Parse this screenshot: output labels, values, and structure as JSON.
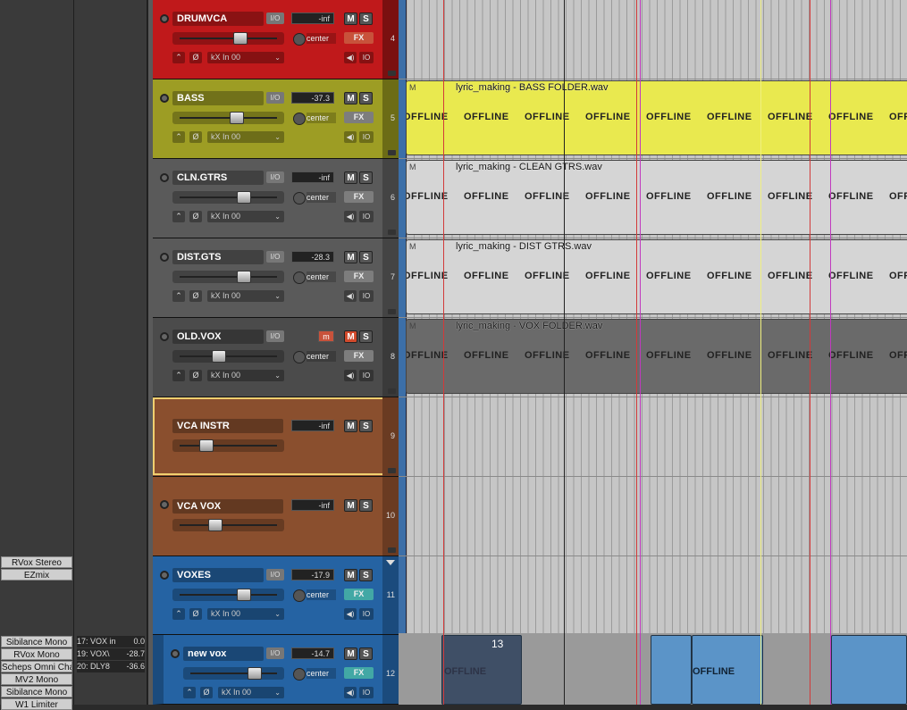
{
  "mixer": {
    "slots_a": [
      "RVox Stereo",
      "EZmix"
    ],
    "slots_b": [
      "Sibilance Mono",
      "RVox Mono",
      "Scheps Omni Cha",
      "MV2 Mono",
      "Sibilance Mono",
      "W1 Limiter"
    ],
    "sends": [
      {
        "label": "17: VOX in",
        "val": "0.0"
      },
      {
        "label": "19: VOX\\",
        "val": "-28.7"
      },
      {
        "label": "20: DLY8",
        "val": "-36.6"
      }
    ]
  },
  "tracks": [
    {
      "num": "4",
      "name": "DRUMVCA",
      "vol": "-inf",
      "pan": "center",
      "fx": "FX",
      "input": "kX In 00",
      "color": "#c0191b"
    },
    {
      "num": "5",
      "name": "BASS",
      "vol": "-37.3",
      "pan": "center",
      "fx": "FX",
      "input": "kX In 00",
      "color": "#9d9d24"
    },
    {
      "num": "6",
      "name": "CLN.GTRS",
      "vol": "-inf",
      "pan": "center",
      "fx": "FX",
      "input": "kX In 00",
      "color": "#5a5a5a"
    },
    {
      "num": "7",
      "name": "DIST.GTS",
      "vol": "-28.3",
      "pan": "center",
      "fx": "FX",
      "input": "kX In 00",
      "color": "#5a5a5a"
    },
    {
      "num": "8",
      "name": "OLD.VOX",
      "vol": "m",
      "pan": "center",
      "fx": "FX",
      "input": "kX In 00",
      "color": "#4b4b4b"
    },
    {
      "num": "9",
      "name": "VCA INSTR",
      "vol": "-inf",
      "color": "#8a4f2e"
    },
    {
      "num": "10",
      "name": "VCA VOX",
      "vol": "-inf",
      "color": "#8a4f2e"
    },
    {
      "num": "11",
      "name": "VOXES",
      "vol": "-17.9",
      "pan": "center",
      "fx": "FX",
      "input": "kX In 00",
      "color": "#2563a3"
    },
    {
      "num": "12",
      "name": "new vox",
      "vol": "-14.7",
      "pan": "center",
      "fx": "FX",
      "input": "kX In 00",
      "color": "#2563a3"
    }
  ],
  "buttons": {
    "io": "I/O",
    "mute": "M",
    "solo": "S",
    "mon": "◀)",
    "io2": "IO",
    "auto": "⌃",
    "phase": "Ø",
    "chev": "⌄"
  },
  "items": {
    "bass": "lyric_making - BASS FOLDER.wav",
    "clean": "lyric_making - CLEAN GTRS.wav",
    "dist": "lyric_making - DIST GTRS.wav",
    "vox": "lyric_making - VOX FOLDER.wav",
    "offline": "OFFLINE",
    "small": "13",
    "item_icons": "M"
  }
}
